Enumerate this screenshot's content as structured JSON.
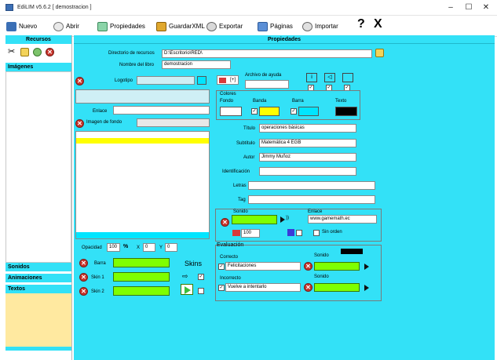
{
  "window": {
    "title": "EdiLIM  v5.6.2   [ demostracion ]",
    "minimize": "–",
    "maximize": "☐",
    "close": "✕"
  },
  "toolbar": {
    "nuevo": "Nuevo",
    "abrir": "Abrir",
    "propiedades": "Propiedades",
    "guardarxml": "GuardarXML",
    "exportar": "Exportar",
    "paginas": "Páginas",
    "importar": "Importar",
    "help": "?",
    "exit": "X"
  },
  "sidebar": {
    "recursos_header": "Recursos",
    "imagenes": "Imágenes",
    "sonidos": "Sonidos",
    "animaciones": "Animaciones",
    "textos": "Textos"
  },
  "main": {
    "header": "Propiedades",
    "directorio_label": "Directorio de recursos",
    "directorio_value": "D:\\Escritorio\\RED\\",
    "nombre_label": "Nombre del libro",
    "nombre_value": "demostracion",
    "logotipo_label": "Logotipo",
    "enlace_label": "Enlace",
    "imagen_fondo_label": "Imagen de fondo",
    "opacidad_label": "Opacidad",
    "opacidad_value": "100",
    "pct": "%",
    "x_label": "X",
    "x_value": "0",
    "y_label": "Y",
    "y_value": "0",
    "barra_label": "Barra",
    "skin1_label": "Skin 1",
    "skin2_label": "Skin 2",
    "skins_label": "Skins",
    "plus_label": "[+]",
    "archivo_ayuda_label": "Archivo de ayuda",
    "colores_label": "Colores",
    "fondo_label": "Fondo",
    "banda_label": "Banda",
    "barra_color_label": "Barra",
    "texto_label": "Texto",
    "titulo_label": "Título",
    "titulo_value": "operaciones básicas",
    "subtitulo_label": "Subtítulo",
    "subtitulo_value": "Matemática 4 EGB",
    "autor_label": "Autor",
    "autor_value": "Jimmy Muñoz",
    "identificacion_label": "Identificación",
    "letras_label": "Letras",
    "tag_label": "Tag",
    "sonido_label": "Sonido",
    "enlace2_label": "Enlace",
    "enlace2_value": "www.gamemath.ec",
    "volumen_value": "100",
    "sin_orden_label": "Sin orden",
    "evaluacion_label": "Evaluación",
    "correcto_label": "Correcto",
    "correcto_value": "Felicitaciones",
    "sonido_correcto_label": "Sonido",
    "incorrecto_label": "Incorrecto",
    "incorrecto_value": "Vuelve a intentarlo",
    "sonido_incorrecto_label": "Sonido"
  },
  "colors": {
    "accent": "#33e1f7",
    "banda": "#ffff00",
    "barra": "#00e5ff",
    "texto": "#000000",
    "fondo": "#ffffff",
    "green": "#7fff00",
    "sidebar_footer": "#ffe9a0"
  }
}
